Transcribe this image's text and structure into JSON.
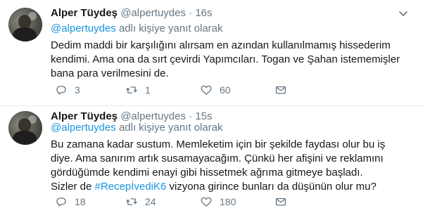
{
  "tweets": [
    {
      "name": "Alper Tüydeş",
      "handle": "@alpertuydes",
      "separator": "·",
      "time": "16s",
      "reply_mention": "@alpertuydes",
      "reply_suffix": "adlı kişiye yanıt olarak",
      "text_lines": [
        "Dedim maddi bir karşılığını alırsam en azından kullanılmamış hissederim",
        "kendimi. Ama ona da sırt çevirdi Yapımcıları. Togan ve Şahan istememişler",
        "bana para verilmesini de."
      ],
      "replies": "3",
      "retweets": "1",
      "likes": "60"
    },
    {
      "name": "Alper Tüydeş",
      "handle": "@alpertuydes",
      "separator": "·",
      "time": "15s",
      "reply_mention": "@alpertuydes",
      "reply_suffix": "adlı kişiye yanıt olarak",
      "text_lines": [
        "Bu zamana kadar sustum. Memleketim için bir şekilde faydası olur bu iş",
        "diye. Ama sanırım artık susamayacağım. Çünkü her afişini ve reklamını",
        "gördüğümde kendimi enayi gibi hissetmek ağrıma gitmeye başladı."
      ],
      "last_line_before": "Sizler de",
      "hashtag": "#RecepİvediK6",
      "last_line_after": "vizyona girince bunları da düşünün olur mu?",
      "replies": "18",
      "retweets": "24",
      "likes": "180"
    }
  ],
  "icons": {
    "more": "chevron-down-icon",
    "reply": "reply-icon",
    "retweet": "retweet-icon",
    "like": "heart-icon",
    "dm": "envelope-icon"
  },
  "colors": {
    "link": "#1b95e0",
    "muted": "#657786",
    "text": "#14171a",
    "divider": "#e6ecf0"
  }
}
